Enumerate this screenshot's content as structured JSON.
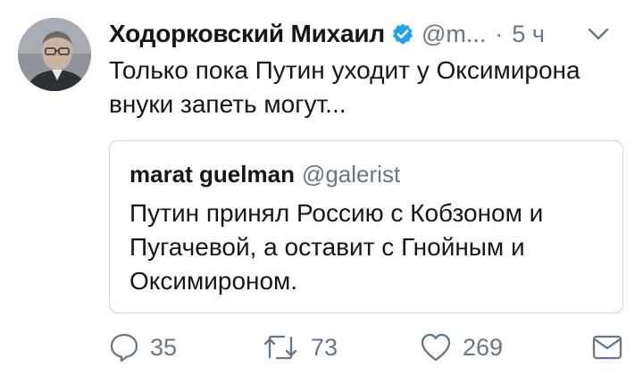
{
  "tweet": {
    "author_name": "Ходорковский Михаил",
    "author_handle": "@m...",
    "separator": "·",
    "time": "5 ч",
    "text": "Только пока Путин уходит у Оксимирона\nвнуки запеть могут...",
    "verified": true,
    "avatar_icon": "avatar-photo-icon"
  },
  "quoted": {
    "author_name": "marat guelman",
    "author_handle": "@galerist",
    "text": "Путин принял Россию с Кобзоном и\nПугачевой, а оставит с Гнойным и\nОксимироном."
  },
  "actions": {
    "replies": "35",
    "retweets": "73",
    "likes": "269"
  },
  "colors": {
    "text": "#14171a",
    "secondary": "#657786",
    "verified_blue": "#1da1f2",
    "border": "#ccd6dd"
  }
}
